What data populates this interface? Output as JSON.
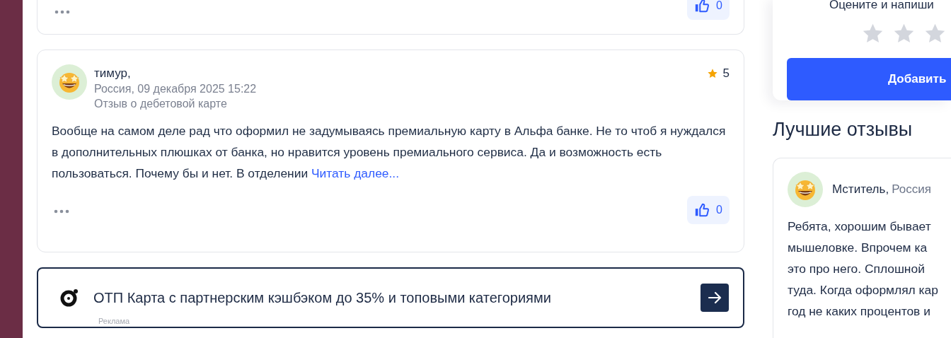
{
  "top_review": {
    "likes": "0"
  },
  "review": {
    "author": "тимур,",
    "meta": "Россия, 09 декабря 2025 15:22",
    "type": "Отзыв о дебетовой карте",
    "rating": "5",
    "text": "Вообще на самом деле рад что оформил не задумываясь премиальную карту в Альфа банке. Не то чтоб я нуждался в дополнительных плюшках от банка, но нравится уровень премиального сервиса. Да и возможность есть пользоваться. Почему бы и нет. В отделении",
    "read_more": "Читать далее...",
    "likes": "0"
  },
  "ad": {
    "title": "ОТП Карта с партнерским кэшбэком до 35% и топовыми категориями",
    "label": "Реклама"
  },
  "rate_card": {
    "prompt": "Оцените и напиши",
    "stars": 0,
    "button": "Добавить"
  },
  "best_reviews": {
    "title": "Лучшие отзывы",
    "items": [
      {
        "author": "Мститель,",
        "country": "Россия",
        "lines": [
          "Ребята, хорошим бывает",
          "мышеловке. Впрочем ка",
          "это про него. Сплошной",
          "туда. Когда оформлял кар",
          "год не каких процентов и"
        ]
      }
    ]
  }
}
